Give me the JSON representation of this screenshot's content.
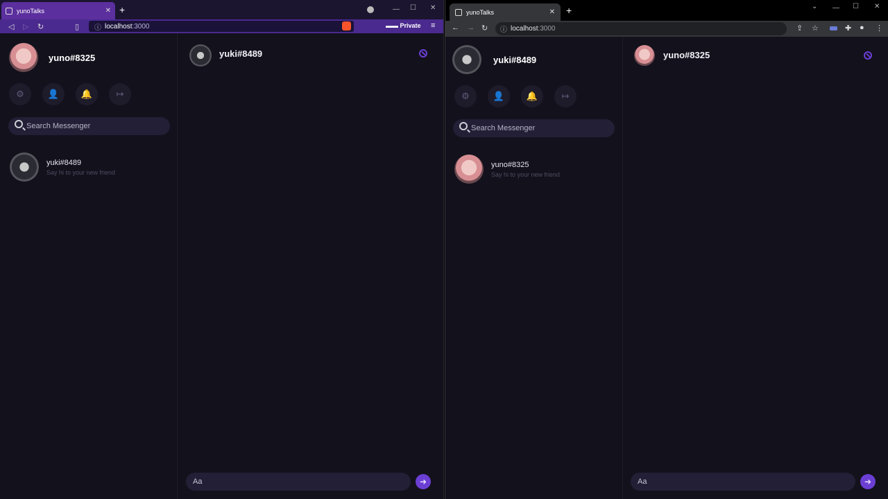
{
  "left_window": {
    "browser": "brave",
    "tab_title": "yunoTalks",
    "url_host": "localhost",
    "url_port": ":3000",
    "private_label": "Private",
    "app": {
      "me_name": "yuno#8325",
      "search_placeholder": "Search Messenger",
      "contacts": [
        {
          "name": "yuki#8489",
          "subtitle": "Say hi to your new friend"
        }
      ],
      "chat_name": "yuki#8489",
      "composer_placeholder": "Aa"
    }
  },
  "right_window": {
    "browser": "chrome",
    "tab_title": "yunoTalks",
    "url_host": "localhost",
    "url_port": ":3000",
    "app": {
      "me_name": "yuki#8489",
      "search_placeholder": "Search Messenger",
      "contacts": [
        {
          "name": "yuno#8325",
          "subtitle": "Say hi to your new friend"
        }
      ],
      "chat_name": "yuno#8325",
      "composer_placeholder": "Aa"
    }
  },
  "colors": {
    "accent": "#6b3fd4",
    "background": "#13111c",
    "brave_bar": "#4a2a8e"
  },
  "icons": {
    "settings": "gear-icon",
    "add_friend": "add-user-icon",
    "notifications": "bell-icon",
    "logout": "logout-icon",
    "block": "block-icon",
    "send": "send-icon"
  }
}
